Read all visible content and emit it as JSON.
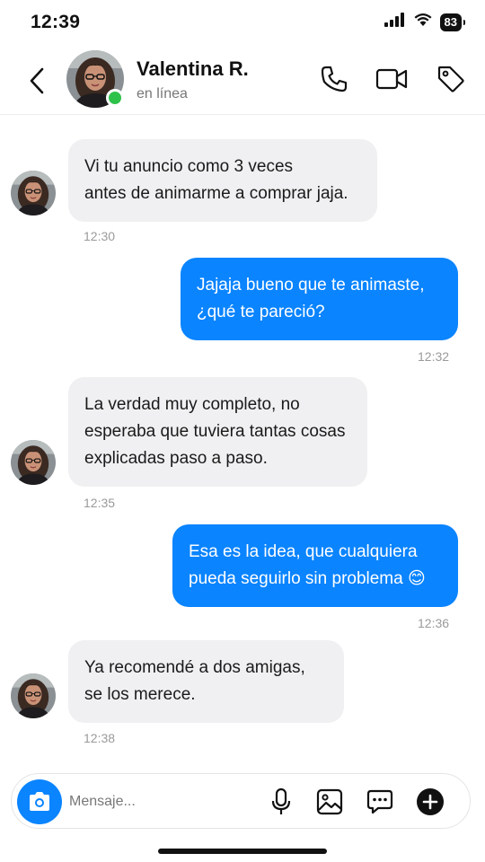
{
  "status_bar": {
    "time": "12:39",
    "battery": "83"
  },
  "header": {
    "name": "Valentina R.",
    "status": "en línea"
  },
  "messages": [
    {
      "from": "contact",
      "lines": [
        "Vi tu anuncio como 3 veces",
        "antes de animarme a comprar jaja."
      ],
      "time": "12:30"
    },
    {
      "from": "me",
      "lines": [
        "Jajaja bueno que te animaste,",
        "¿qué te pareció?"
      ],
      "time": "12:32"
    },
    {
      "from": "contact",
      "lines": [
        "La verdad muy completo, no",
        "esperaba que tuviera tantas cosas",
        "explicadas paso a paso."
      ],
      "time": "12:35"
    },
    {
      "from": "me",
      "lines": [
        "Esa es la idea, que cualquiera",
        "pueda seguirlo sin problema 😊"
      ],
      "time": "12:36"
    },
    {
      "from": "contact",
      "lines": [
        "Ya recomendé a dos amigas,",
        "se los merece."
      ],
      "time": "12:38"
    }
  ],
  "composer": {
    "placeholder": "Mensaje..."
  },
  "icons": {
    "back": "chevron-left-icon",
    "call": "phone-icon",
    "video": "video-camera-icon",
    "tag": "tag-icon",
    "camera": "camera-icon",
    "mic": "microphone-icon",
    "gallery": "image-icon",
    "more": "chat-dots-icon",
    "add": "plus-circle-icon"
  },
  "colors": {
    "accent": "#0a84ff",
    "online": "#2ec24a",
    "incoming_bubble": "#f0f0f2"
  }
}
